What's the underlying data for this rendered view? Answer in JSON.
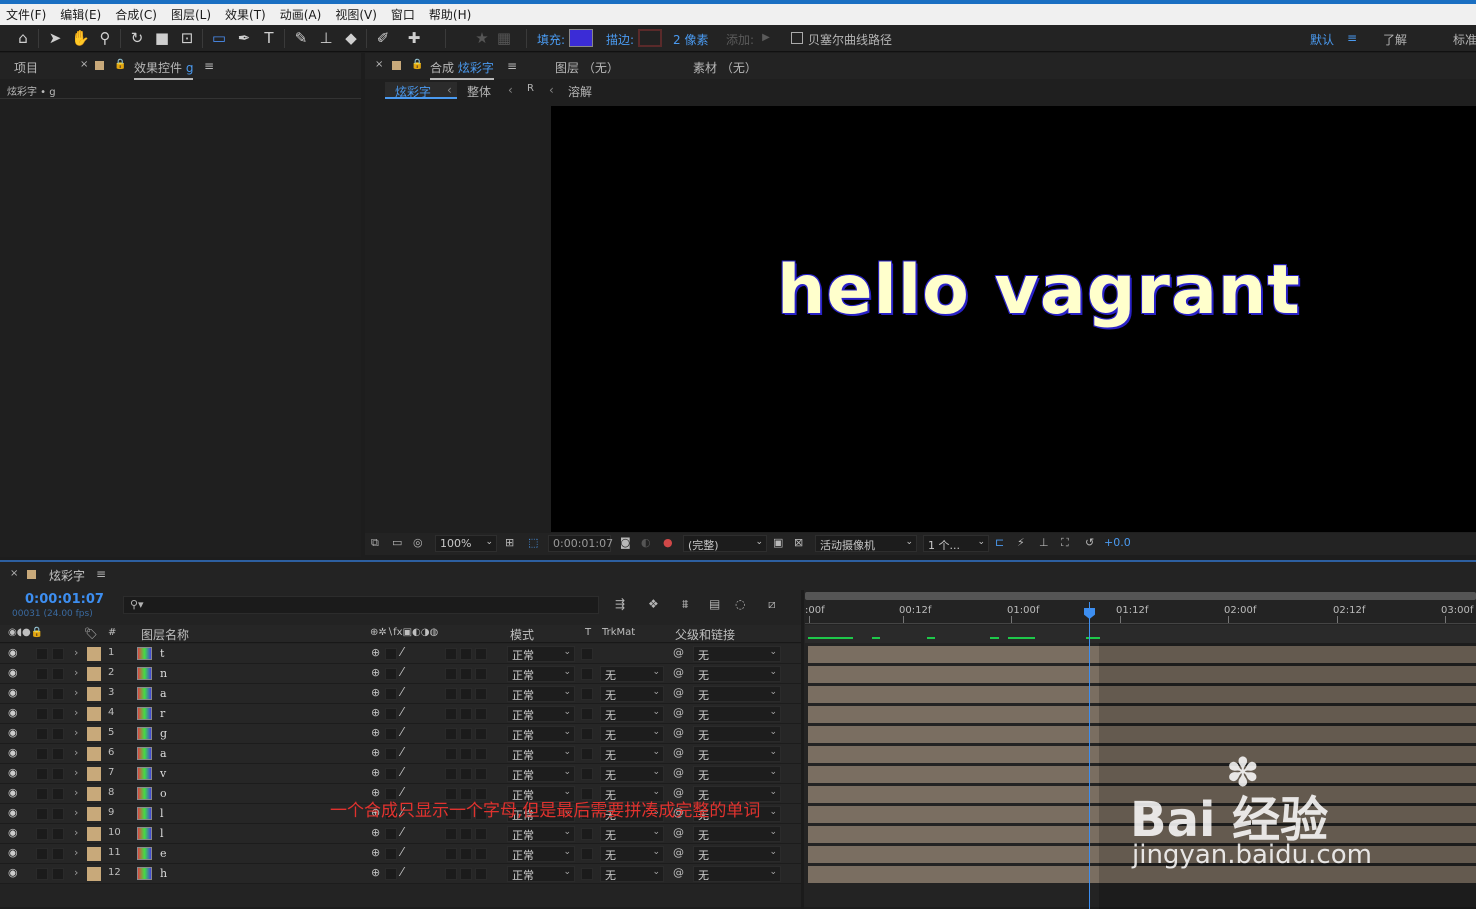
{
  "menu": [
    "文件(F)",
    "编辑(E)",
    "合成(C)",
    "图层(L)",
    "效果(T)",
    "动画(A)",
    "视图(V)",
    "窗口",
    "帮助(H)"
  ],
  "toolbar": {
    "fill_label": "填充:",
    "stroke_label": "描边:",
    "stroke_width": "2 像素",
    "add_label": "添加:",
    "bezier_label": "贝塞尔曲线路径",
    "workspace_default": "默认",
    "workspace_learn": "了解",
    "workspace_standard": "标准",
    "fill_color": "#3b2cd6",
    "stroke_color": "#5a2a2a"
  },
  "left_panel": {
    "tab_project": "项目",
    "tab_effects": "效果控件",
    "tab_effects_suffix": "g",
    "crumb": "炫彩字 • g"
  },
  "viewer": {
    "tab_comp_prefix": "合成",
    "tab_comp_name": "炫彩字",
    "tab_layer": "图层 （无）",
    "tab_footage": "素材 （无）",
    "crumbs": [
      "炫彩字",
      "整体",
      "R",
      "溶解"
    ],
    "canvas_text": "hello vagrant",
    "zoom": "100%",
    "timecode": "0:00:01:07",
    "resolution": "(完整)",
    "camera": "活动摄像机",
    "views": "1 个...",
    "exposure": "+0.0"
  },
  "timeline": {
    "comp_name": "炫彩字",
    "timecode": "0:00:01:07",
    "frame_info": "00031 (24.00 fps)",
    "headers": {
      "num": "#",
      "layer_name": "图层名称",
      "mode": "模式",
      "t": "T",
      "trkmat": "TrkMat",
      "parent": "父级和链接"
    },
    "ruler": [
      ":00f",
      "00:12f",
      "01:00f",
      "01:12f",
      "02:00f",
      "02:12f",
      "03:00f"
    ],
    "layers": [
      {
        "num": "1",
        "name": "t",
        "mode": "正常",
        "trkmat": "",
        "parent": "无"
      },
      {
        "num": "2",
        "name": "n",
        "mode": "正常",
        "trkmat": "无",
        "parent": "无"
      },
      {
        "num": "3",
        "name": "a",
        "mode": "正常",
        "trkmat": "无",
        "parent": "无"
      },
      {
        "num": "4",
        "name": "r",
        "mode": "正常",
        "trkmat": "无",
        "parent": "无"
      },
      {
        "num": "5",
        "name": "g",
        "mode": "正常",
        "trkmat": "无",
        "parent": "无"
      },
      {
        "num": "6",
        "name": "a",
        "mode": "正常",
        "trkmat": "无",
        "parent": "无"
      },
      {
        "num": "7",
        "name": "v",
        "mode": "正常",
        "trkmat": "无",
        "parent": "无"
      },
      {
        "num": "8",
        "name": "o",
        "mode": "正常",
        "trkmat": "无",
        "parent": "无"
      },
      {
        "num": "9",
        "name": "l",
        "mode": "正常",
        "trkmat": "无",
        "parent": "无"
      },
      {
        "num": "10",
        "name": "l",
        "mode": "正常",
        "trkmat": "无",
        "parent": "无"
      },
      {
        "num": "11",
        "name": "e",
        "mode": "正常",
        "trkmat": "无",
        "parent": "无"
      },
      {
        "num": "12",
        "name": "h",
        "mode": "正常",
        "trkmat": "无",
        "parent": "无"
      }
    ],
    "annotation": "一个合成只显示一个字母,但是最后需要拼凑成完整的单词"
  },
  "watermark": {
    "brand": "Bai 经验",
    "url": "jingyan.baidu.com"
  }
}
